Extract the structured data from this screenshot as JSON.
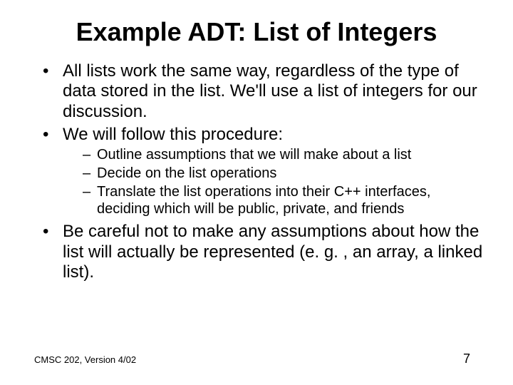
{
  "title": "Example ADT:  List of Integers",
  "bullets": [
    "All lists work the same way, regardless of the type of data stored in the list.  We'll use a list of integers for our discussion.",
    "We will follow this procedure:"
  ],
  "sub_bullets": [
    "Outline assumptions that we will make about a list",
    "Decide on the list operations",
    "Translate the list operations into their C++ interfaces, deciding which will be public, private, and friends"
  ],
  "bullet_after": "Be careful not to make any assumptions about how the list will actually be represented (e. g. , an array, a linked list).",
  "footer_left": "CMSC 202, Version 4/02",
  "footer_right": "7"
}
